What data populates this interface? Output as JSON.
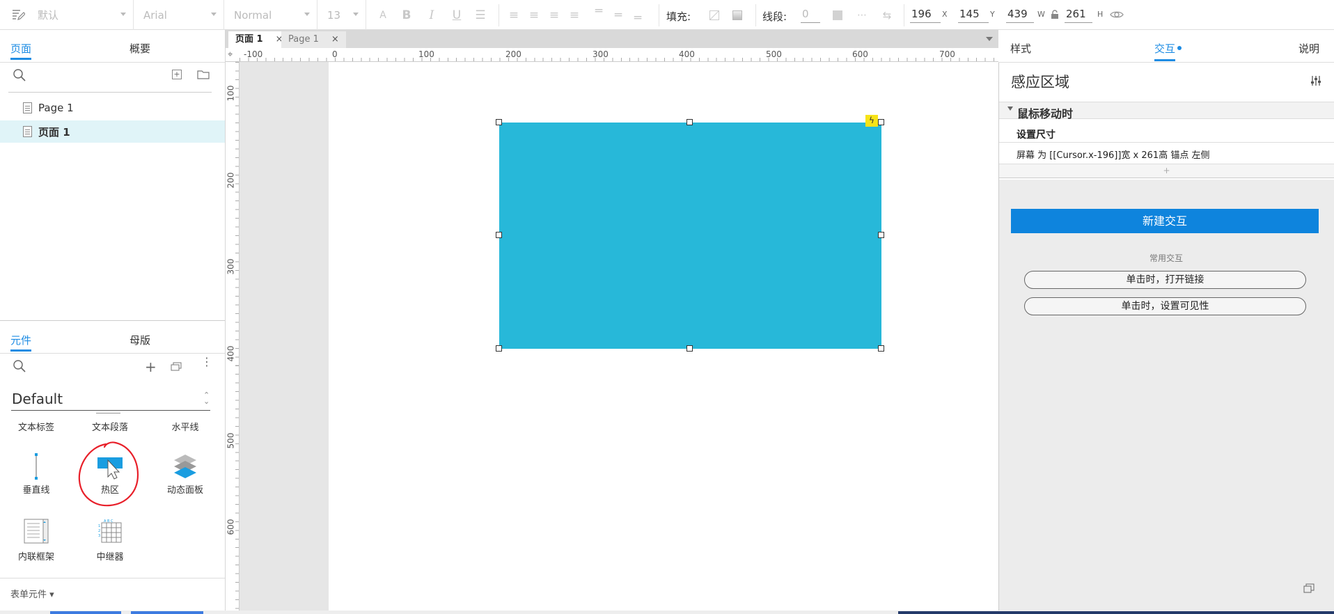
{
  "toolbar": {
    "style_select": "默认",
    "font_select": "Arial",
    "weight_select": "Normal",
    "size_select": "13",
    "fill_label": "填充:",
    "stroke_label": "线段:",
    "stroke_value": "0",
    "x_value": "196",
    "x_unit": "X",
    "y_value": "145",
    "y_unit": "Y",
    "w_value": "439",
    "w_unit": "W",
    "h_value": "261",
    "h_unit": "H"
  },
  "left_panel": {
    "tabs": [
      "页面",
      "概要"
    ],
    "pages": [
      {
        "label": "Page 1",
        "selected": false
      },
      {
        "label": "页面 1",
        "selected": true
      }
    ],
    "lib_tabs": [
      "元件",
      "母版"
    ],
    "library_name": "Default",
    "widgets": [
      {
        "label": "文本标签",
        "icon": "text-label-icon"
      },
      {
        "label": "文本段落",
        "icon": "text-paragraph-icon"
      },
      {
        "label": "水平线",
        "icon": "horizontal-line-icon"
      },
      {
        "label": "垂直线",
        "icon": "vertical-line-icon"
      },
      {
        "label": "热区",
        "icon": "hotspot-icon"
      },
      {
        "label": "动态面板",
        "icon": "dynamic-panel-icon"
      },
      {
        "label": "内联框架",
        "icon": "inline-frame-icon"
      },
      {
        "label": "中继器",
        "icon": "repeater-icon"
      }
    ],
    "form_widgets": "表单元件 ▾"
  },
  "doc_tabs": [
    {
      "label": "页面 1",
      "active": true
    },
    {
      "label": "Page 1",
      "active": false
    }
  ],
  "ruler_h": [
    "-100",
    "0",
    "100",
    "200",
    "300",
    "400",
    "500",
    "600",
    "700"
  ],
  "ruler_v": [
    "100",
    "200",
    "300",
    "400",
    "500",
    "600"
  ],
  "right_panel": {
    "tabs": [
      "样式",
      "交互",
      "说明"
    ],
    "title": "感应区域",
    "event": "鼠标移动时",
    "action": "设置尺寸",
    "action_detail": "屏幕 为 [[Cursor.x-196]]宽 x 261高  锚点 左侧",
    "add_plus": "+",
    "new_interaction": "新建交互",
    "common_label": "常用交互",
    "common_buttons": [
      "单击时，打开链接",
      "单击时，设置可见性"
    ]
  },
  "colors": {
    "accent": "#1e8ce3",
    "hotspot_fill": "#27b8d9",
    "button_blue": "#0e84dd",
    "annotation_red": "#e8202a"
  }
}
